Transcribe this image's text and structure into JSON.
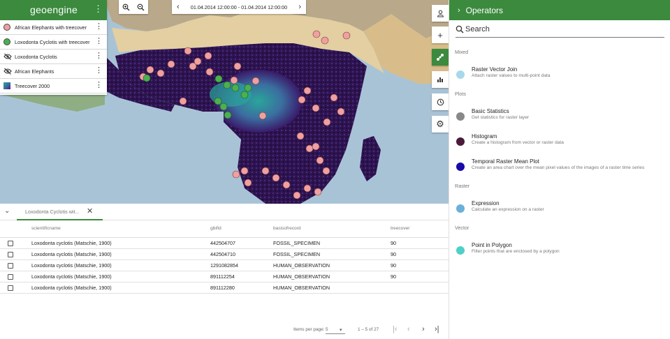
{
  "brand": {
    "logo_text": "geoengine"
  },
  "layers": [
    {
      "name": "African Elephants with treecover",
      "icon": "circle-swatch",
      "color": "#f0a0a0"
    },
    {
      "name": "Loxodonta Cyclotis with treecover",
      "icon": "circle-swatch",
      "color": "#4caf50"
    },
    {
      "name": "Loxodonta Cyclotis",
      "icon": "visibility-off-icon"
    },
    {
      "name": "African Elephants",
      "icon": "visibility-off-icon"
    },
    {
      "name": "Treecover 2000",
      "icon": "raster-gradient-icon"
    }
  ],
  "time": {
    "range": "01.04.2014 12:00:00 - 01.04.2014 12:00:00"
  },
  "table": {
    "tab_label": "Loxodonta Cyclotis wit...",
    "columns": [
      "scientificname",
      "gbifid",
      "basisofrecord",
      "treecover"
    ],
    "rows": [
      [
        "Loxodonta cyclotis (Matschie, 1900)",
        "442504707",
        "FOSSIL_SPECIMEN",
        "90"
      ],
      [
        "Loxodonta cyclotis (Matschie, 1900)",
        "442504710",
        "FOSSIL_SPECIMEN",
        "90"
      ],
      [
        "Loxodonta cyclotis (Matschie, 1900)",
        "1291082854",
        "HUMAN_OBSERVATION",
        "90"
      ],
      [
        "Loxodonta cyclotis (Matschie, 1900)",
        "891112254",
        "HUMAN_OBSERVATION",
        "90"
      ],
      [
        "Loxodonta cyclotis (Matschie, 1900)",
        "891112280",
        "HUMAN_OBSERVATION",
        ""
      ]
    ],
    "paginator": {
      "items_per_page_label": "Items per page:",
      "page_size": "5",
      "range_label": "1 – 5 of 27"
    }
  },
  "operators": {
    "title": "Operators",
    "search_placeholder": "Search",
    "groups": [
      {
        "label": "Mixed",
        "items": [
          {
            "name": "Raster Vector Join",
            "description": "Attach raster values to multi-point data",
            "color": "#a8d8ea"
          }
        ]
      },
      {
        "label": "Plots",
        "items": [
          {
            "name": "Basic Statistics",
            "description": "Get statistics for raster layer",
            "color": "#888888"
          },
          {
            "name": "Histogram",
            "description": "Create a histogram from vector or raster data",
            "color": "#4a1a3a"
          },
          {
            "name": "Temporal Raster Mean Plot",
            "description": "Create an area chart over the mean pixel values of the images of a raster time series",
            "color": "#1a0aa8"
          }
        ]
      },
      {
        "label": "Raster",
        "items": [
          {
            "name": "Expression",
            "description": "Calculate an expression on a raster",
            "color": "#6ab0d8"
          }
        ]
      },
      {
        "label": "Vector",
        "items": [
          {
            "name": "Point in Polygon",
            "description": "Filter points that are enclosed by a polygon",
            "color": "#4dd0c8"
          }
        ]
      }
    ]
  },
  "colors": {
    "accent": "#3b8a3e"
  }
}
